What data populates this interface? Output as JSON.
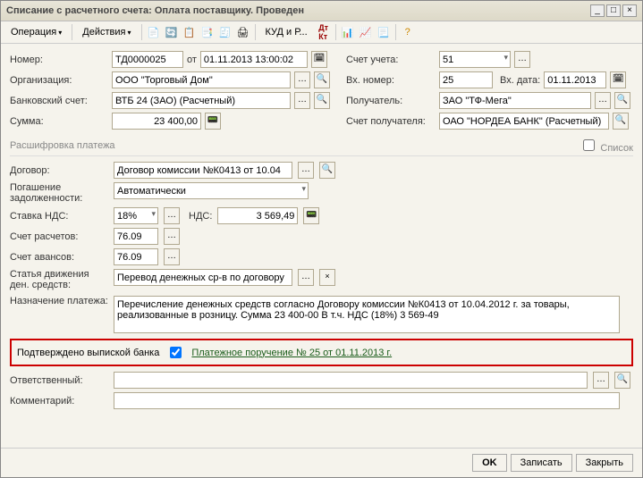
{
  "window": {
    "title": "Списание с расчетного счета: Оплата поставщику. Проведен"
  },
  "toolbar": {
    "operation": "Операция",
    "actions": "Действия",
    "kudir": "КУД и Р..."
  },
  "left": {
    "number_lbl": "Номер:",
    "number": "ТД0000025",
    "ot": "от",
    "date": "01.11.2013 13:00:02",
    "org_lbl": "Организация:",
    "org": "ООО \"Торговый Дом\"",
    "bank_lbl": "Банковский счет:",
    "bank": "ВТБ 24 (ЗАО) (Расчетный)",
    "sum_lbl": "Сумма:",
    "sum": "23 400,00"
  },
  "right": {
    "acct_lbl": "Счет учета:",
    "acct": "51",
    "vhnum_lbl": "Вх. номер:",
    "vhnum": "25",
    "vhdate_lbl": "Вх. дата:",
    "vhdate": "01.11.2013",
    "recv_lbl": "Получатель:",
    "recv": "ЗАО \"ТФ-Мега\"",
    "recvacct_lbl": "Счет получателя:",
    "recvacct": "ОАО \"НОРДЕА БАНК\" (Расчетный)"
  },
  "section": {
    "title": "Расшифровка платежа",
    "list_lbl": "Список"
  },
  "detail": {
    "contract_lbl": "Договор:",
    "contract": "Договор комиссии №К0413 от 10.04",
    "debt_lbl": "Погашение задолженности:",
    "debt": "Автоматически",
    "nds_rate_lbl": "Ставка НДС:",
    "nds_rate": "18%",
    "nds_lbl": "НДС:",
    "nds": "3 569,49",
    "acct1_lbl": "Счет расчетов:",
    "acct1": "76.09",
    "acct2_lbl": "Счет авансов:",
    "acct2": "76.09",
    "flow_lbl": "Статья движения ден. средств:",
    "flow": "Перевод денежных ср-в по договору",
    "purpose_lbl": "Назначение платежа:",
    "purpose": "Перечисление денежных средств согласно Договору комиссии №К0413 от 10.04.2012 г. за товары, реализованные в розницу. Сумма 23 400-00 В т.ч. НДС (18%) 3 569-49"
  },
  "confirm": {
    "lbl": "Подтверждено выпиской банка",
    "link": "Платежное поручение № 25 от 01.11.2013 г."
  },
  "bottom": {
    "resp_lbl": "Ответственный:",
    "resp": "",
    "comment_lbl": "Комментарий:",
    "comment": ""
  },
  "footer": {
    "ok": "OK",
    "save": "Записать",
    "close": "Закрыть"
  }
}
